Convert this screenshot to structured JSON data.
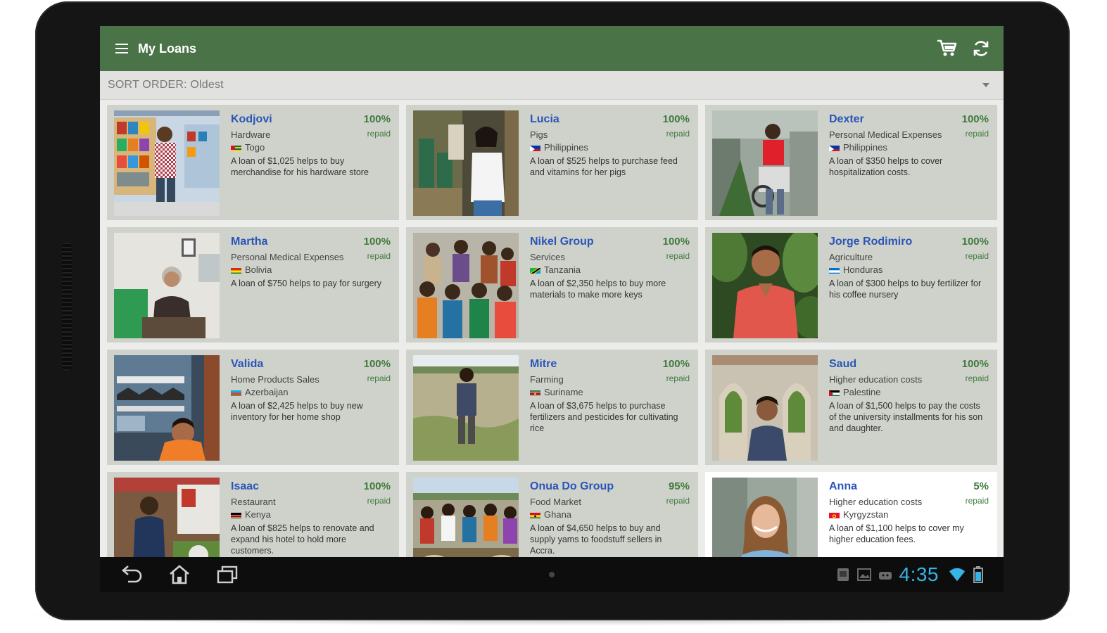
{
  "app": {
    "title": "My Loans"
  },
  "sort": {
    "label": "SORT ORDER: Oldest"
  },
  "icons": {
    "menu": "menu-icon",
    "cart": "cart-icon",
    "refresh": "refresh-icon",
    "back": "back-icon",
    "home": "home-icon",
    "recents": "recents-icon"
  },
  "colors": {
    "action_bar": "#4a7448",
    "name_link": "#2a55b8",
    "percent": "#3f7a3d",
    "card": "#cfd2cb",
    "clock": "#36b4e6"
  },
  "loans": [
    {
      "name": "Kodjovi",
      "sector": "Hardware",
      "country": "Togo",
      "percent": "100%",
      "status": "repaid",
      "description": "A loan of $1,025 helps to buy merchandise for his hardware store"
    },
    {
      "name": "Lucia",
      "sector": "Pigs",
      "country": "Philippines",
      "percent": "100%",
      "status": "repaid",
      "description": "A loan of $525 helps to purchase feed and vitamins for her pigs"
    },
    {
      "name": "Dexter",
      "sector": "Personal Medical Expenses",
      "country": "Philippines",
      "percent": "100%",
      "status": "repaid",
      "description": "A loan of $350 helps to cover hospitalization costs."
    },
    {
      "name": "Martha",
      "sector": "Personal Medical Expenses",
      "country": "Bolivia",
      "percent": "100%",
      "status": "repaid",
      "description": "A loan of $750 helps to pay for surgery"
    },
    {
      "name": "Nikel Group",
      "sector": "Services",
      "country": "Tanzania",
      "percent": "100%",
      "status": "repaid",
      "description": "A loan of $2,350 helps to buy more materials to make more keys"
    },
    {
      "name": "Jorge Rodimiro",
      "sector": "Agriculture",
      "country": "Honduras",
      "percent": "100%",
      "status": "repaid",
      "description": "A loan of $300 helps to buy fertilizer for his coffee nursery"
    },
    {
      "name": "Valida",
      "sector": "Home Products Sales",
      "country": "Azerbaijan",
      "percent": "100%",
      "status": "repaid",
      "description": "A loan of $2,425 helps to buy new inventory for her home shop"
    },
    {
      "name": "Mitre",
      "sector": "Farming",
      "country": "Suriname",
      "percent": "100%",
      "status": "repaid",
      "description": "A loan of $3,675 helps to purchase fertilizers and pesticides for cultivating rice"
    },
    {
      "name": "Saud",
      "sector": "Higher education costs",
      "country": "Palestine",
      "percent": "100%",
      "status": "repaid",
      "description": "A loan of $1,500 helps to pay the costs of the university installments for his son and daughter."
    },
    {
      "name": "Isaac",
      "sector": "Restaurant",
      "country": "Kenya",
      "percent": "100%",
      "status": "repaid",
      "description": "A loan of $825 helps to renovate and expand his hotel to hold more customers."
    },
    {
      "name": "Onua Do Group",
      "sector": "Food Market",
      "country": "Ghana",
      "percent": "95%",
      "status": "repaid",
      "description": "A loan of $4,650 helps to buy and supply yams to foodstuff sellers in Accra."
    },
    {
      "name": "Anna",
      "sector": "Higher education costs",
      "country": "Kyrgyzstan",
      "percent": "5%",
      "status": "repaid",
      "description": "A loan of $1,100 helps to cover my higher education fees."
    }
  ],
  "status_bar": {
    "time": "4:35"
  }
}
